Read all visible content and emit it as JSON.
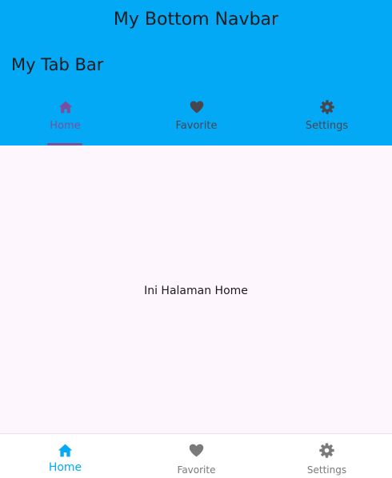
{
  "appbar": {
    "title": "My Bottom Navbar",
    "color": "#03a9f4"
  },
  "tabbar": {
    "title": "My Tab Bar",
    "active_color": "#7b4fa0",
    "inactive_color": "#49454f",
    "tabs": [
      {
        "label": "Home",
        "icon": "home-icon",
        "active": true
      },
      {
        "label": "Favorite",
        "icon": "heart-icon",
        "active": false
      },
      {
        "label": "Settings",
        "icon": "gear-icon",
        "active": false
      }
    ]
  },
  "main": {
    "text": "Ini Halaman Home"
  },
  "bottom_nav": {
    "active_color": "#03a9f4",
    "inactive_color": "#7a7a7a",
    "items": [
      {
        "label": "Home",
        "icon": "home-icon",
        "active": true
      },
      {
        "label": "Favorite",
        "icon": "heart-icon",
        "active": false
      },
      {
        "label": "Settings",
        "icon": "gear-icon",
        "active": false
      }
    ]
  }
}
